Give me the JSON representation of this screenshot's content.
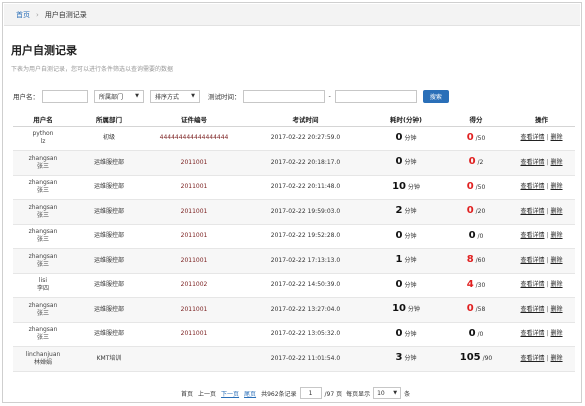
{
  "breadcrumb": {
    "home": "首页",
    "current": "用户自测记录"
  },
  "page_title": "用户自测记录",
  "hint": "下表为用户自测记录，您可以进行条件筛选以查询需要的数据",
  "filters": {
    "username_label": "用户名：",
    "username_value": "",
    "department_select": "所属部门",
    "sort_select": "排序方式",
    "time_label": "测试时间：",
    "time_start": "",
    "time_dash": "-",
    "time_end": "",
    "search_button": "搜索"
  },
  "table": {
    "headers": [
      "用户名",
      "所属部门",
      "证件编号",
      "考试时间",
      "耗时(分钟)",
      "得分",
      "操作"
    ],
    "duration_unit": "分钟",
    "detail_label": "查看详情",
    "delete_label": "删除",
    "divider": "|",
    "rows": [
      {
        "user_id": "python",
        "user_name": "lz",
        "dept": "初级",
        "cert": "444444444444444444",
        "time": "2017-02-22 20:27:59.0",
        "duration": "0",
        "score": "0",
        "score_max": "/50",
        "score_color": "#e02020"
      },
      {
        "user_id": "zhangsan",
        "user_name": "张三",
        "dept": "运维服控部",
        "cert": "2011001",
        "time": "2017-02-22 20:18:17.0",
        "duration": "0",
        "score": "0",
        "score_max": "/2",
        "score_color": "#e02020"
      },
      {
        "user_id": "zhangsan",
        "user_name": "张三",
        "dept": "运维服控部",
        "cert": "2011001",
        "time": "2017-02-22 20:11:48.0",
        "duration": "10",
        "score": "0",
        "score_max": "/50",
        "score_color": "#e02020"
      },
      {
        "user_id": "zhangsan",
        "user_name": "张三",
        "dept": "运维服控部",
        "cert": "2011001",
        "time": "2017-02-22 19:59:03.0",
        "duration": "2",
        "score": "0",
        "score_max": "/20",
        "score_color": "#e02020"
      },
      {
        "user_id": "zhangsan",
        "user_name": "张三",
        "dept": "运维服控部",
        "cert": "2011001",
        "time": "2017-02-22 19:52:28.0",
        "duration": "0",
        "score": "0",
        "score_max": "/0",
        "score_color": "#111111"
      },
      {
        "user_id": "zhangsan",
        "user_name": "张三",
        "dept": "运维服控部",
        "cert": "2011001",
        "time": "2017-02-22 17:13:13.0",
        "duration": "1",
        "score": "8",
        "score_max": "/60",
        "score_color": "#e02020"
      },
      {
        "user_id": "lisi",
        "user_name": "李四",
        "dept": "运维服控部",
        "cert": "2011002",
        "time": "2017-02-22 14:50:39.0",
        "duration": "0",
        "score": "4",
        "score_max": "/30",
        "score_color": "#e02020"
      },
      {
        "user_id": "zhangsan",
        "user_name": "张三",
        "dept": "运维服控部",
        "cert": "2011001",
        "time": "2017-02-22 13:27:04.0",
        "duration": "10",
        "score": "0",
        "score_max": "/58",
        "score_color": "#e02020"
      },
      {
        "user_id": "zhangsan",
        "user_name": "张三",
        "dept": "运维服控部",
        "cert": "2011001",
        "time": "2017-02-22 13:05:32.0",
        "duration": "0",
        "score": "0",
        "score_max": "/0",
        "score_color": "#111111"
      },
      {
        "user_id": "linchanjuan",
        "user_name": "林婵娟",
        "dept": "KMT培训",
        "cert": "",
        "time": "2017-02-22 11:01:54.0",
        "duration": "3",
        "score": "105",
        "score_max": "/90",
        "score_color": "#111111"
      }
    ]
  },
  "pager": {
    "first": "首页",
    "prev": "上一页",
    "next": "下一页",
    "last": "尾页",
    "total": "共962条记录",
    "page": "1",
    "page_total": "/97 页",
    "per_page_label": "每页显示",
    "per_page": "10",
    "per_page_unit": "条"
  }
}
